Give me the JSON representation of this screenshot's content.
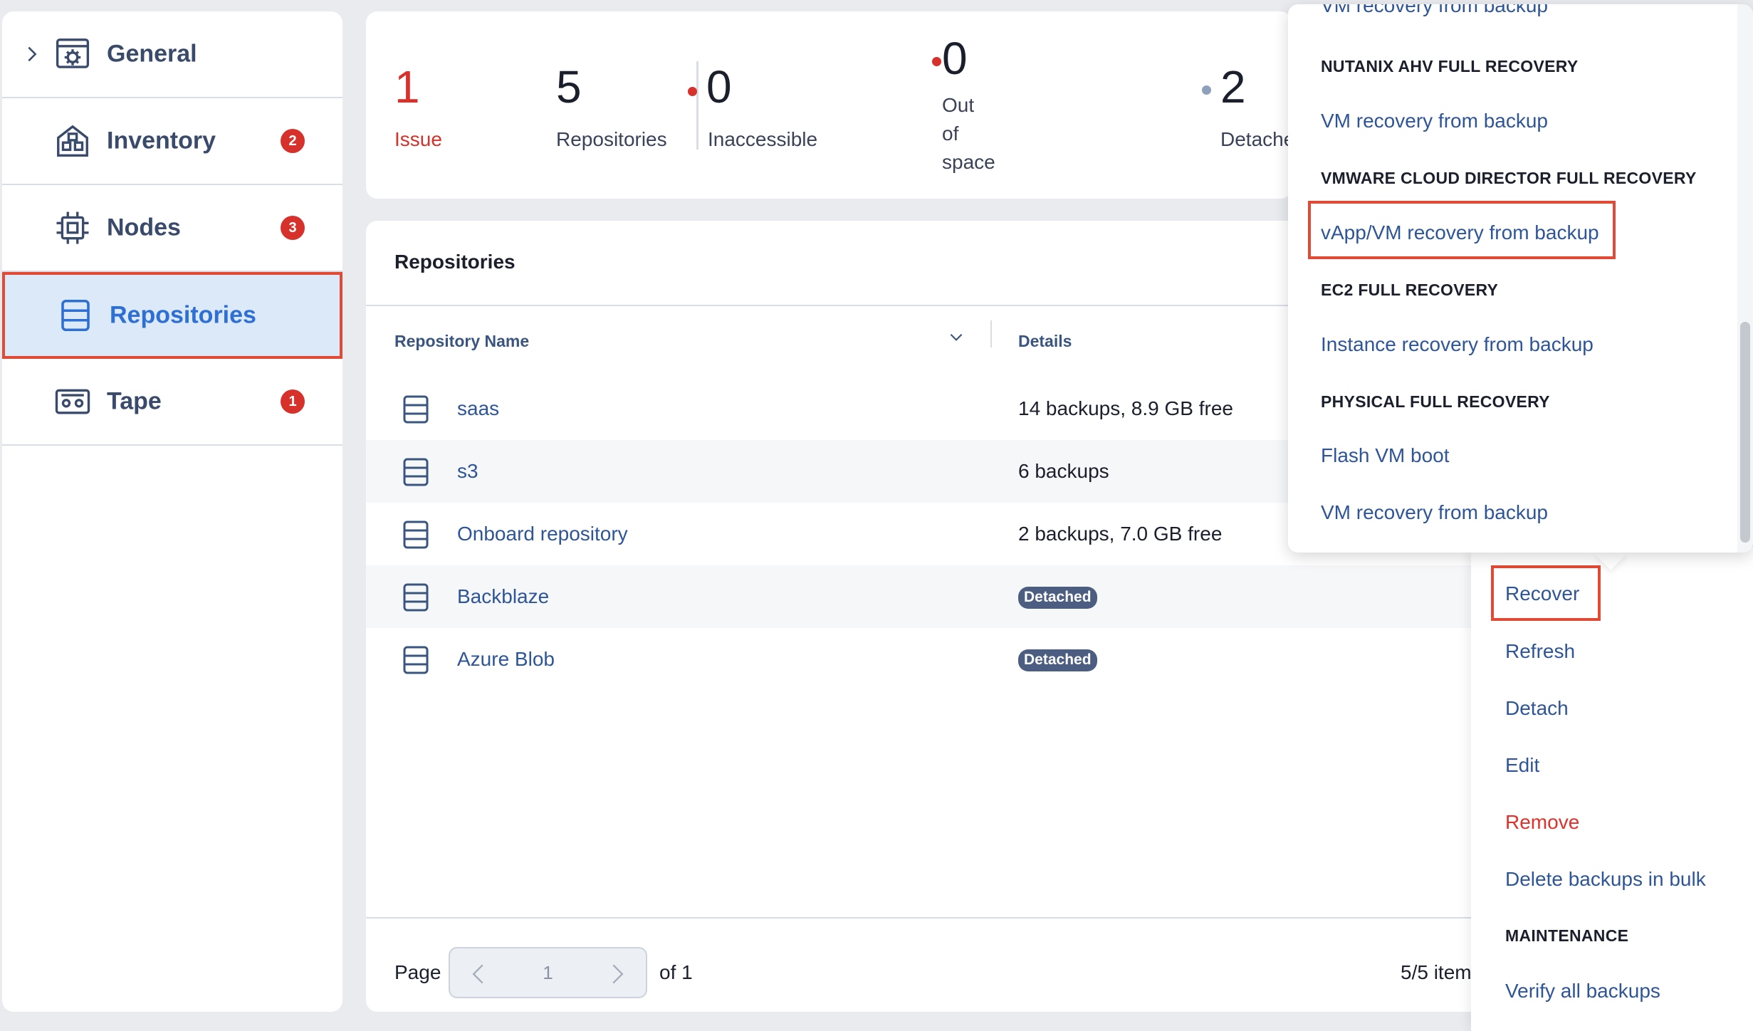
{
  "sidebar": {
    "items": [
      {
        "label": "General",
        "icon": "settings-window-icon",
        "badge": ""
      },
      {
        "label": "Inventory",
        "icon": "building-icon",
        "badge": "2"
      },
      {
        "label": "Nodes",
        "icon": "chip-icon",
        "badge": "3"
      },
      {
        "label": "Repositories",
        "icon": "database-icon",
        "badge": ""
      },
      {
        "label": "Tape",
        "icon": "tape-icon",
        "badge": "1"
      }
    ],
    "active_item": "Repositories"
  },
  "stats": {
    "issues": {
      "value": "1",
      "label": "Issue",
      "color": "#d6312a"
    },
    "repositories": {
      "value": "5",
      "label": "Repositories"
    },
    "inaccessible": {
      "value": "0",
      "label": "Inaccessible",
      "dot_color": "#d6312a"
    },
    "out_of_space": {
      "value": "0",
      "label_lines": [
        "Out",
        "of",
        "space"
      ],
      "dot_color": "#d6312a"
    },
    "detached": {
      "value": "2",
      "label": "Detache",
      "dot_color": "#8fa0bd"
    }
  },
  "repositories_panel": {
    "title": "Repositories",
    "columns": [
      "Repository Name",
      "Details"
    ],
    "rows": [
      {
        "name": "saas",
        "details": "14 backups, 8.9 GB free",
        "tag": ""
      },
      {
        "name": "s3",
        "details": "6 backups",
        "tag": ""
      },
      {
        "name": "Onboard repository",
        "details": "2 backups, 7.0 GB free",
        "tag": ""
      },
      {
        "name": "Backblaze",
        "details": "",
        "tag": "Detached"
      },
      {
        "name": "Azure Blob",
        "details": "",
        "tag": "Detached"
      }
    ],
    "pagination": {
      "label": "Page",
      "current": "1",
      "of": "of 1",
      "items": "5/5 item"
    }
  },
  "action_menu": {
    "items": [
      "Recover",
      "Refresh",
      "Detach",
      "Edit",
      "Remove",
      "Delete backups in bulk"
    ],
    "section_maintenance": "MAINTENANCE",
    "maintenance_items": [
      "Verify all backups"
    ],
    "danger_color": "#e0312a"
  },
  "recovery_popup": {
    "top_cut_item": "VM recovery from backup",
    "sections": [
      {
        "heading": "NUTANIX AHV FULL RECOVERY",
        "items": [
          "VM recovery from backup"
        ]
      },
      {
        "heading": "VMWARE CLOUD DIRECTOR FULL RECOVERY",
        "items": [
          "vApp/VM recovery from backup"
        ]
      },
      {
        "heading": "EC2 FULL RECOVERY",
        "items": [
          "Instance recovery from backup"
        ]
      },
      {
        "heading": "PHYSICAL FULL RECOVERY",
        "items": [
          "Flash VM boot",
          "VM recovery from backup"
        ]
      }
    ]
  },
  "colors": {
    "accent": "#2d6fd3",
    "link": "#2e5597",
    "highlight_border": "#e14a34",
    "badge": "#d6312a",
    "tag_bg": "#4b5d80"
  }
}
